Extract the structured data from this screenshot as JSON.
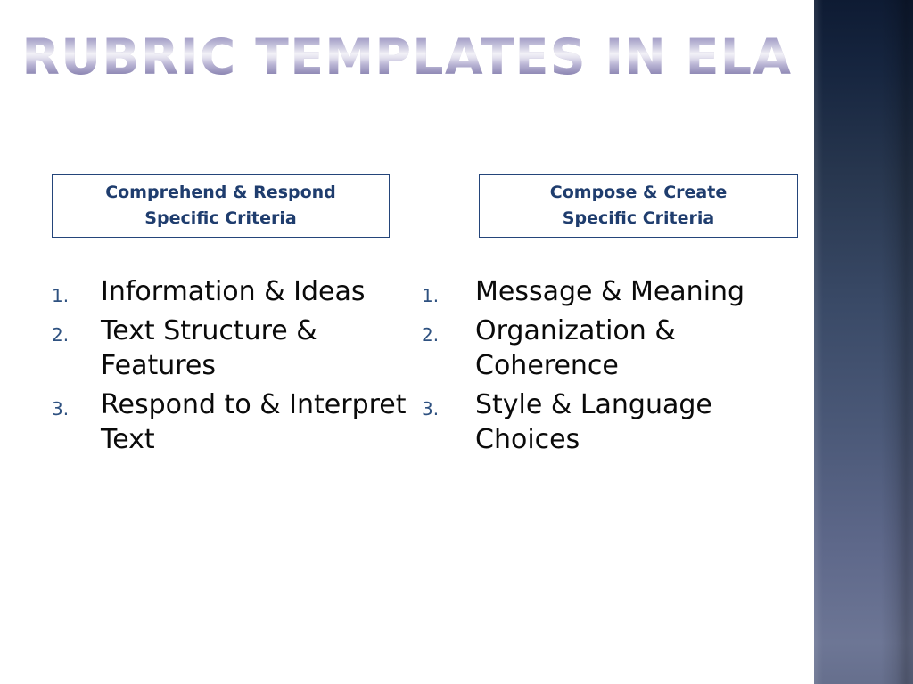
{
  "slide": {
    "title": "Rubric Templates in ELA",
    "background_color": "#ffffff",
    "accent_band_color_top": "#0e1b33",
    "accent_band_color_bottom": "#6d7695",
    "title_gradient_from": "#9a95c0",
    "title_gradient_to": "#7d76a8",
    "box_border_color": "#24457a",
    "box_text_color": "#1f3d6e",
    "number_color": "#2e5180",
    "body_text_color": "#0a0a0a"
  },
  "columns": [
    {
      "header_line1": "Comprehend & Respond",
      "header_line2": "Specific Criteria",
      "items": [
        {
          "number": "1.",
          "text": "Information & Ideas"
        },
        {
          "number": "2.",
          "text": "Text Structure & Features"
        },
        {
          "number": "3.",
          "text": "Respond to & Interpret Text"
        }
      ]
    },
    {
      "header_line1": "Compose & Create",
      "header_line2": "Specific Criteria",
      "items": [
        {
          "number": "1.",
          "text": "Message & Meaning"
        },
        {
          "number": "2.",
          "text": "Organization & Coherence"
        },
        {
          "number": "3.",
          "text": "Style & Language Choices"
        }
      ]
    }
  ]
}
